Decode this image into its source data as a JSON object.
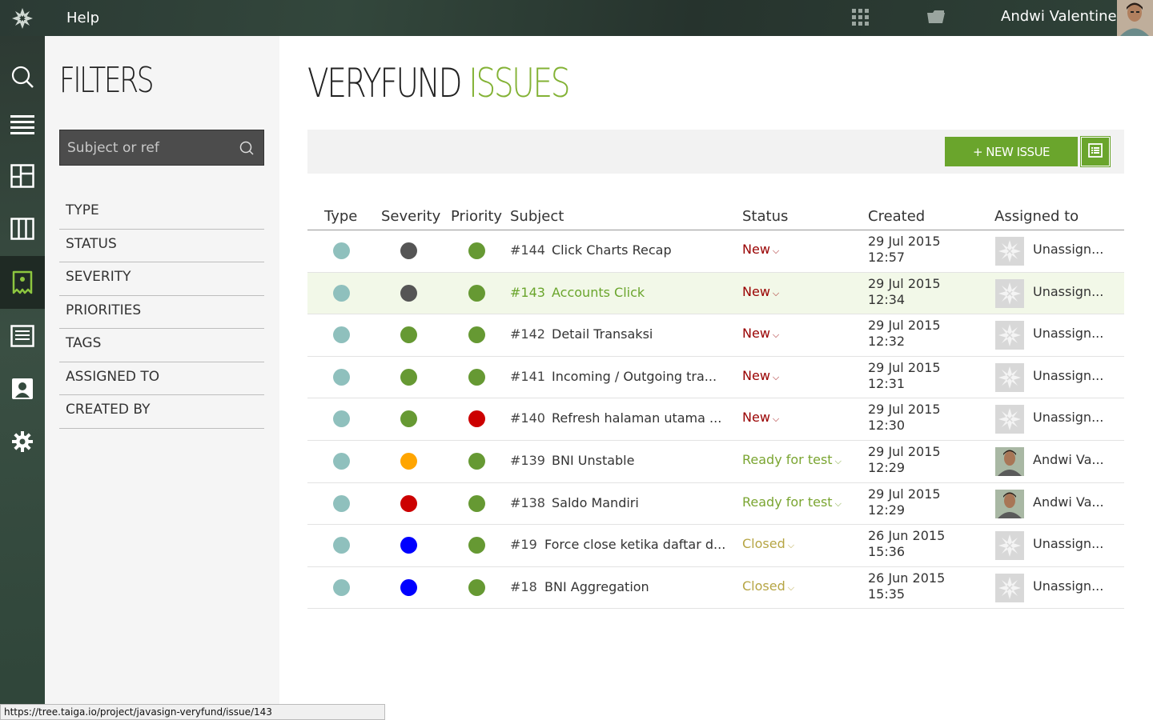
{
  "topbar": {
    "help_label": "Help",
    "username": "Andwi Valentine",
    "bg_color": "#2b3a34"
  },
  "sidenav": {
    "items": [
      "search-icon",
      "backlog-icon",
      "kanban-board-icon",
      "columns-icon",
      "issues-icon",
      "wiki-icon",
      "team-icon",
      "settings-icon"
    ],
    "active": "issues-icon",
    "accent": "#8dc63f"
  },
  "filters": {
    "title": "FILTERS",
    "search_placeholder": "Subject or ref",
    "items": [
      "TYPE",
      "STATUS",
      "SEVERITY",
      "PRIORITIES",
      "TAGS",
      "ASSIGNED TO",
      "CREATED BY"
    ]
  },
  "main": {
    "title_project": "VERYFUND",
    "title_section": "ISSUES",
    "new_issue_label": "+ NEW ISSUE",
    "accent": "#83b235"
  },
  "table": {
    "headers": {
      "type": "Type",
      "severity": "Severity",
      "priority": "Priority",
      "subject": "Subject",
      "status": "Status",
      "created": "Created",
      "assigned": "Assigned to"
    },
    "rows": [
      {
        "type_color": "#8fc0bd",
        "severity_color": "#555555",
        "priority_color": "#669933",
        "ref": "#144",
        "subject": "Click Charts Recap",
        "status": "New",
        "status_color": "#990000",
        "created_date": "29 Jul 2015",
        "created_time": "12:57",
        "assigned": "Unassign...",
        "assigned_avatar": "default",
        "highlight": false
      },
      {
        "type_color": "#8fc0bd",
        "severity_color": "#555555",
        "priority_color": "#669933",
        "ref": "#143",
        "subject": "Accounts Click",
        "status": "New",
        "status_color": "#990000",
        "created_date": "29 Jul 2015",
        "created_time": "12:34",
        "assigned": "Unassign...",
        "assigned_avatar": "default",
        "highlight": true
      },
      {
        "type_color": "#8fc0bd",
        "severity_color": "#669933",
        "priority_color": "#669933",
        "ref": "#142",
        "subject": "Detail Transaksi",
        "status": "New",
        "status_color": "#990000",
        "created_date": "29 Jul 2015",
        "created_time": "12:32",
        "assigned": "Unassign...",
        "assigned_avatar": "default",
        "highlight": false
      },
      {
        "type_color": "#8fc0bd",
        "severity_color": "#669933",
        "priority_color": "#669933",
        "ref": "#141",
        "subject": "Incoming / Outgoing tra...",
        "status": "New",
        "status_color": "#990000",
        "created_date": "29 Jul 2015",
        "created_time": "12:31",
        "assigned": "Unassign...",
        "assigned_avatar": "default",
        "highlight": false
      },
      {
        "type_color": "#8fc0bd",
        "severity_color": "#669933",
        "priority_color": "#cc0000",
        "ref": "#140",
        "subject": "Refresh halaman utama ...",
        "status": "New",
        "status_color": "#990000",
        "created_date": "29 Jul 2015",
        "created_time": "12:30",
        "assigned": "Unassign...",
        "assigned_avatar": "default",
        "highlight": false
      },
      {
        "type_color": "#8fc0bd",
        "severity_color": "#ffa500",
        "priority_color": "#669933",
        "ref": "#139",
        "subject": "BNI Unstable",
        "status": "Ready for test",
        "status_color": "#7aa531",
        "created_date": "29 Jul 2015",
        "created_time": "12:29",
        "assigned": "Andwi Va...",
        "assigned_avatar": "photo",
        "highlight": false
      },
      {
        "type_color": "#8fc0bd",
        "severity_color": "#cc0000",
        "priority_color": "#669933",
        "ref": "#138",
        "subject": "Saldo Mandiri",
        "status": "Ready for test",
        "status_color": "#7aa531",
        "created_date": "29 Jul 2015",
        "created_time": "12:29",
        "assigned": "Andwi Va...",
        "assigned_avatar": "photo",
        "highlight": false
      },
      {
        "type_color": "#8fc0bd",
        "severity_color": "#0000ff",
        "priority_color": "#669933",
        "ref": "#19",
        "subject": "Force close ketika daftar d...",
        "status": "Closed",
        "status_color": "#b6a544",
        "created_date": "26 Jun 2015",
        "created_time": "15:36",
        "assigned": "Unassign...",
        "assigned_avatar": "default",
        "highlight": false
      },
      {
        "type_color": "#8fc0bd",
        "severity_color": "#0000ff",
        "priority_color": "#669933",
        "ref": "#18",
        "subject": "BNI Aggregation",
        "status": "Closed",
        "status_color": "#b6a544",
        "created_date": "26 Jun 2015",
        "created_time": "15:35",
        "assigned": "Unassign...",
        "assigned_avatar": "default",
        "highlight": false
      }
    ]
  },
  "browser": {
    "status_url": "https://tree.taiga.io/project/javasign-veryfund/issue/143"
  }
}
